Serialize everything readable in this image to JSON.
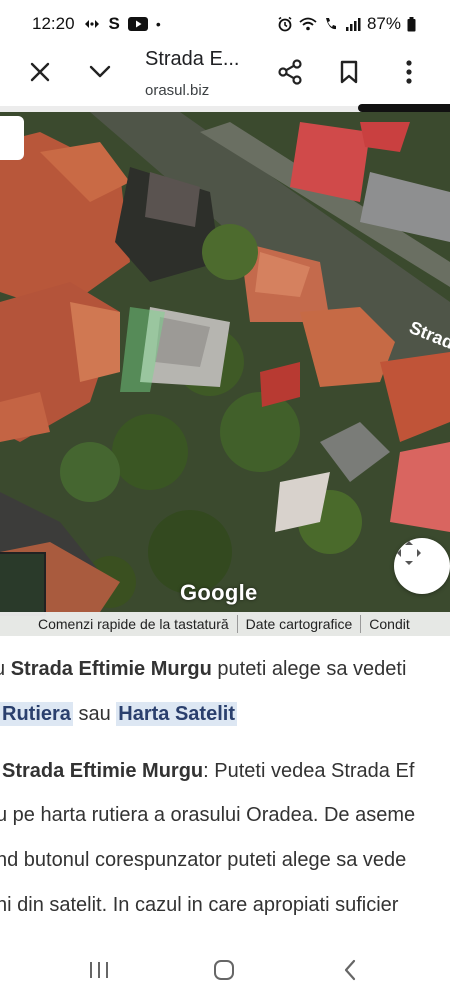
{
  "status_bar": {
    "time": "12:20",
    "s_label": "S",
    "dot": "•",
    "battery": "87%"
  },
  "toolbar": {
    "title": "Strada E...",
    "subtitle": "orasul.biz"
  },
  "map": {
    "street_label": "Strada",
    "google_logo": "Google",
    "footer": {
      "shortcuts": "Comenzi rapide de la tastatură",
      "map_data": "Date cartografice",
      "terms": "Condit"
    }
  },
  "article": {
    "p1_l1_prefix": "u ",
    "p1_l1_bold": "Strada Eftimie Murgu",
    "p1_l1_suffix": " puteti alege sa vedeti",
    "p1_l2_link1": "Rutiera",
    "p1_l2_mid": " sau ",
    "p1_l2_link2": "Harta Satelit",
    "p2_l1_bold": "Strada Eftimie Murgu",
    "p2_l1_suffix": ": Puteti vedea Strada Ef",
    "p2_l2": "u pe harta rutiera a orasului Oradea. De aseme",
    "p2_l3": "nd butonul corespunzator puteti alege sa vede",
    "p2_l4": "ni din satelit. In cazul in care apropiati suficier"
  },
  "colors": {
    "highlight_bg": "#dde7f3",
    "link_text": "#2a3f6d"
  }
}
